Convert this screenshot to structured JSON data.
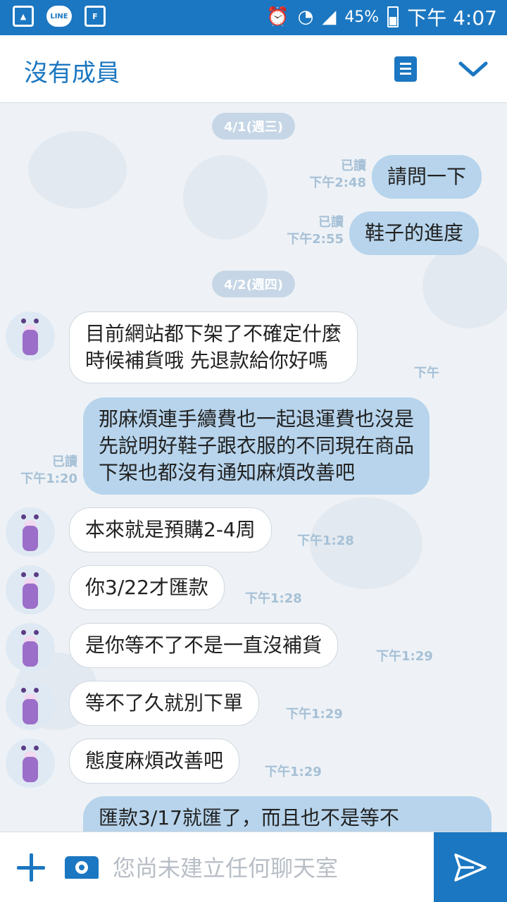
{
  "status_bar": {
    "battery": "45%",
    "time": "下午 4:07",
    "line_label": "LINE"
  },
  "header": {
    "title": "沒有成員"
  },
  "messages": [
    {
      "type": "date",
      "text": "4/1(週三)"
    },
    {
      "type": "me",
      "text": "請問一下",
      "read": "已讀",
      "time": "下午2:48"
    },
    {
      "type": "me",
      "text": "鞋子的進度",
      "read": "已讀",
      "time": "下午2:55"
    },
    {
      "type": "date",
      "text": "4/2(週四)"
    },
    {
      "type": "them",
      "text": "目前網站都下架了不確定什麼\n時候補貨哦 先退款給你好嗎",
      "time": "下午"
    },
    {
      "type": "me",
      "text": "那麻煩連手續費也一起退運費也沒是\n先說明好鞋子跟衣服的不同現在商品\n下架也都沒有通知麻煩改善吧",
      "read": "已讀",
      "time": "下午1:20"
    },
    {
      "type": "them",
      "text": "本來就是預購2-4周",
      "time": "下午1:28"
    },
    {
      "type": "them",
      "text": "你3/22才匯款",
      "time": "下午1:28"
    },
    {
      "type": "them",
      "text": "是你等不了不是一直沒補貨",
      "time": "下午1:29"
    },
    {
      "type": "them",
      "text": "等不了久就別下單",
      "time": "下午1:29"
    },
    {
      "type": "them",
      "text": "態度麻煩改善吧",
      "time": "下午1:29"
    },
    {
      "type": "me",
      "text": "匯款3/17就匯了，而且也不是等不"
    }
  ],
  "input": {
    "placeholder": "您尚未建立任何聊天室"
  },
  "colors": {
    "brand_blue": "#1b77c1",
    "my_bubble": "#b7d4ec",
    "their_bubble": "#ffffff",
    "chat_bg": "#eef2f6"
  }
}
